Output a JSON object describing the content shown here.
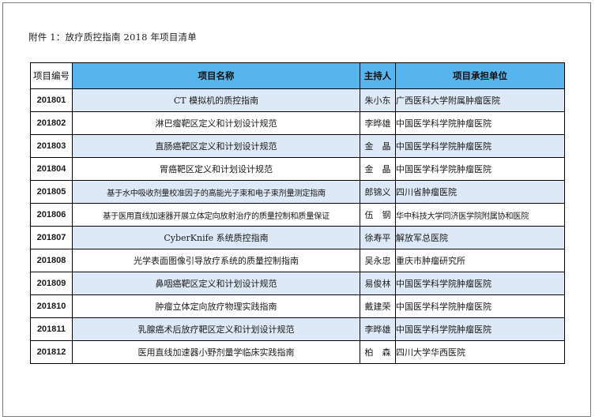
{
  "heading": "附件 1：放疗质控指南 2018 年项目清单",
  "table": {
    "columns": {
      "id": "项目编号",
      "name": "项目名称",
      "lead": "主持人",
      "unit": "项目承担单位"
    },
    "rows": [
      {
        "id": "201801",
        "name": "CT 模拟机的质控指南",
        "lead": "朱小东",
        "unit": "广西医科大学附属肿瘤医院",
        "shaded": true
      },
      {
        "id": "201802",
        "name": "淋巴瘤靶区定义和计划设计规范",
        "lead": "李晔雄",
        "unit": "中国医学科学院肿瘤医院",
        "shaded": false
      },
      {
        "id": "201803",
        "name": "直肠癌靶区定义和计划设计规范",
        "lead": "金　晶",
        "unit": "中国医学科学院肿瘤医院",
        "shaded": true
      },
      {
        "id": "201804",
        "name": "胃癌靶区定义和计划设计规范",
        "lead": "金　晶",
        "unit": "中国医学科学院肿瘤医院",
        "shaded": false
      },
      {
        "id": "201805",
        "name": "基于水中吸收剂量校准因子的高能光子束和电子束剂量测定指南",
        "lead": "郎锦义",
        "unit": "四川省肿瘤医院",
        "shaded": true
      },
      {
        "id": "201806",
        "name": "基于医用直线加速器开展立体定向放射治疗的质量控制和质量保证",
        "lead": "伍　钢",
        "unit": "华中科技大学同济医学院附属协和医院",
        "shaded": false
      },
      {
        "id": "201807",
        "name": "CyberKnife 系统质控指南",
        "lead": "徐寿平",
        "unit": "解放军总医院",
        "shaded": true
      },
      {
        "id": "201808",
        "name": "光学表面图像引导放疗系统的质量控制指南",
        "lead": "吴永忠",
        "unit": "重庆市肿瘤研究所",
        "shaded": false
      },
      {
        "id": "201809",
        "name": "鼻咽癌靶区定义和计划设计规范",
        "lead": "易俊林",
        "unit": "中国医学科学院肿瘤医院",
        "shaded": true
      },
      {
        "id": "201810",
        "name": "肿瘤立体定向放疗物理实践指南",
        "lead": "戴建荣",
        "unit": "中国医学科学院肿瘤医院",
        "shaded": false
      },
      {
        "id": "201811",
        "name": "乳腺癌术后放疗靶区定义和计划设计规范",
        "lead": "李晔雄",
        "unit": "中国医学科学院肿瘤医院",
        "shaded": true
      },
      {
        "id": "201812",
        "name": "医用直线加速器小野剂量学临床实践指南",
        "lead": "柏　森",
        "unit": "四川大学华西医院",
        "shaded": false
      }
    ]
  }
}
